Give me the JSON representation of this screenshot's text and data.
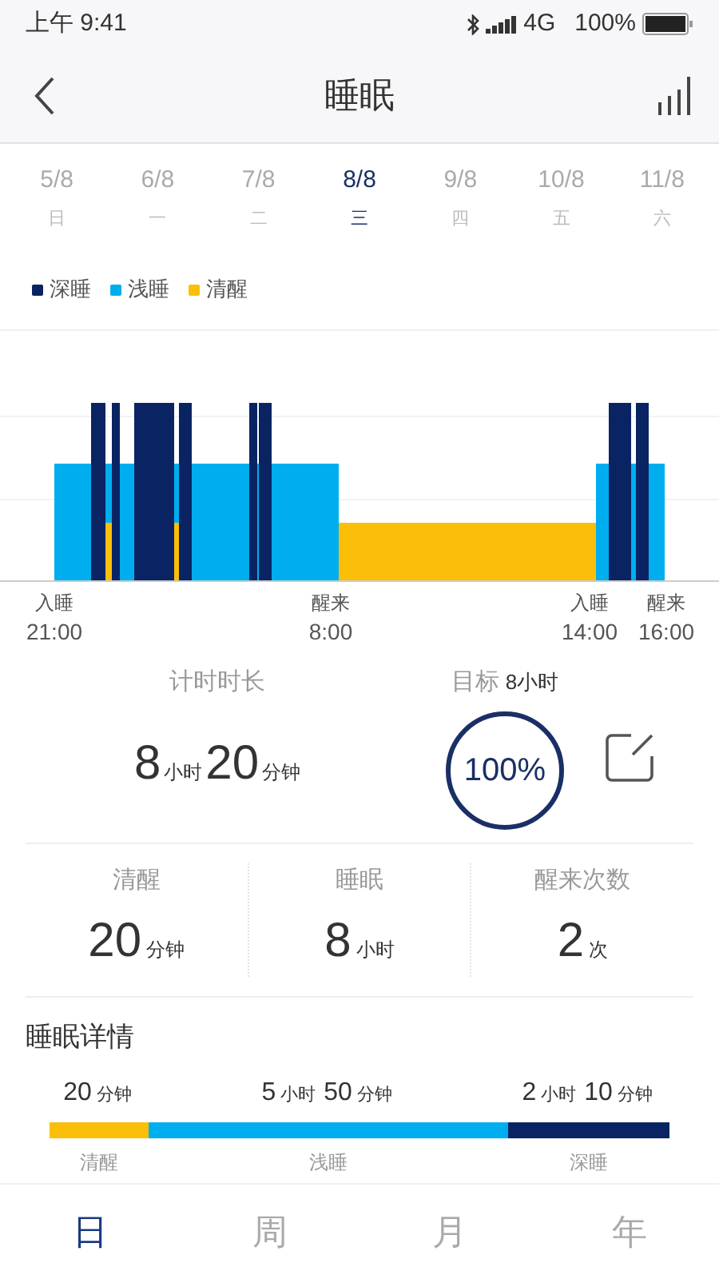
{
  "status_bar": {
    "time": "上午 9:41",
    "network": "4G",
    "battery": "100%"
  },
  "header": {
    "title": "睡眠"
  },
  "dates": [
    {
      "date": "5/8",
      "weekday": "日",
      "selected": false
    },
    {
      "date": "6/8",
      "weekday": "一",
      "selected": false
    },
    {
      "date": "7/8",
      "weekday": "二",
      "selected": false
    },
    {
      "date": "8/8",
      "weekday": "三",
      "selected": true
    },
    {
      "date": "9/8",
      "weekday": "四",
      "selected": false
    },
    {
      "date": "10/8",
      "weekday": "五",
      "selected": false
    },
    {
      "date": "11/8",
      "weekday": "六",
      "selected": false
    }
  ],
  "legend": [
    {
      "label": "深睡",
      "color": "#0a2463"
    },
    {
      "label": "浅睡",
      "color": "#00aeef"
    },
    {
      "label": "清醒",
      "color": "#fbbf0a"
    }
  ],
  "timeline": [
    {
      "event": "入睡",
      "time": "21:00"
    },
    {
      "event": "醒来",
      "time": "8:00"
    },
    {
      "event": "入睡",
      "time": "14:00"
    },
    {
      "event": "醒来",
      "time": "16:00"
    }
  ],
  "duration": {
    "label": "计时时长",
    "hours": "8",
    "hours_unit": "小时",
    "minutes": "20",
    "minutes_unit": "分钟"
  },
  "goal": {
    "label": "目标",
    "value": "8小时",
    "percent": "100%"
  },
  "stats": [
    {
      "label": "清醒",
      "value": "20",
      "unit": "分钟"
    },
    {
      "label": "睡眠",
      "value": "8",
      "unit": "小时"
    },
    {
      "label": "醒来次数",
      "value": "2",
      "unit": "次"
    }
  ],
  "details": {
    "title": "睡眠详情",
    "segments": [
      {
        "parts": [
          {
            "num": "20",
            "unit": "分钟"
          }
        ],
        "label": "清醒",
        "color": "#fbbf0a"
      },
      {
        "parts": [
          {
            "num": "5",
            "unit": "小时"
          },
          {
            "num": "50",
            "unit": "分钟"
          }
        ],
        "label": "浅睡",
        "color": "#00aeef"
      },
      {
        "parts": [
          {
            "num": "2",
            "unit": "小时"
          },
          {
            "num": "10",
            "unit": "分钟"
          }
        ],
        "label": "深睡",
        "color": "#0a2463"
      }
    ]
  },
  "tabs": [
    {
      "label": "日",
      "selected": true
    },
    {
      "label": "周",
      "selected": false
    },
    {
      "label": "月",
      "selected": false
    },
    {
      "label": "年",
      "selected": false
    }
  ]
}
